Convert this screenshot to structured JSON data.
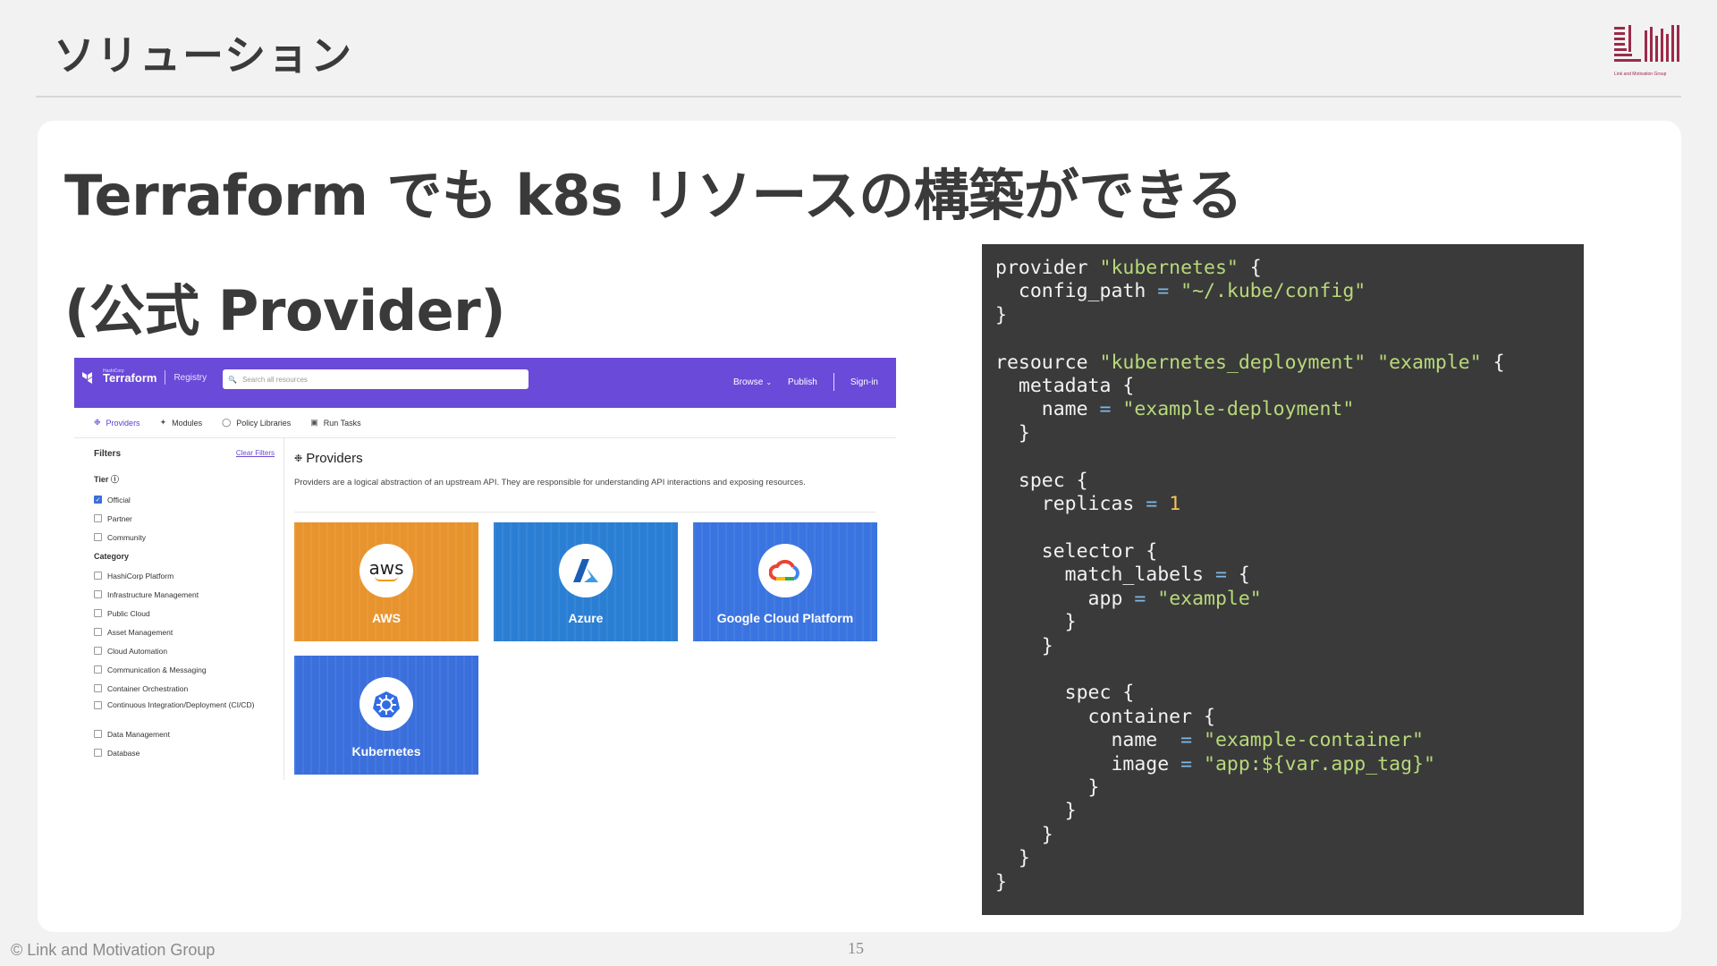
{
  "slide": {
    "title": "ソリューション",
    "headline_line1": "Terraform でも k8s リソースの構築ができる",
    "headline_line2": "(公式 Provider)",
    "page_number": "15",
    "footer": "© Link and Motivation Group",
    "logo_caption": "Link and Motivation Group"
  },
  "registry": {
    "brand_small": "HashiCorp",
    "brand_name": "Terraform",
    "brand_section": "Registry",
    "search_placeholder": "Search all resources",
    "nav": {
      "browse": "Browse",
      "publish": "Publish",
      "signin": "Sign-in"
    },
    "tabs": [
      {
        "label": "Providers",
        "icon": "provider-icon"
      },
      {
        "label": "Modules",
        "icon": "module-icon"
      },
      {
        "label": "Policy Libraries",
        "icon": "shield-icon"
      },
      {
        "label": "Run Tasks",
        "icon": "run-task-icon"
      }
    ],
    "filters": {
      "title": "Filters",
      "clear": "Clear Filters",
      "tier_label": "Tier",
      "tiers": [
        {
          "label": "Official",
          "checked": true
        },
        {
          "label": "Partner",
          "checked": false
        },
        {
          "label": "Community",
          "checked": false
        }
      ],
      "category_label": "Category",
      "categories": [
        "HashiCorp Platform",
        "Infrastructure Management",
        "Public Cloud",
        "Asset Management",
        "Cloud Automation",
        "Communication & Messaging",
        "Container Orchestration",
        "Continuous Integration/Deployment (CI/CD)",
        "Data Management",
        "Database"
      ]
    },
    "main": {
      "title": "Providers",
      "description": "Providers are a logical abstraction of an upstream API. They are responsible for understanding API interactions and exposing resources.",
      "tiles": [
        {
          "name": "AWS",
          "logo": "aws-logo",
          "color": "#e8942e"
        },
        {
          "name": "Azure",
          "logo": "azure-logo",
          "color": "#2a7fd4"
        },
        {
          "name": "Google Cloud Platform",
          "logo": "gcp-logo",
          "color": "#3a74e0"
        },
        {
          "name": "Kubernetes",
          "logo": "kubernetes-logo",
          "color": "#3a6fdc"
        }
      ]
    }
  },
  "code": {
    "language": "hcl",
    "lines": [
      "provider \"kubernetes\" {",
      "  config_path = \"~/.kube/config\"",
      "}",
      "",
      "resource \"kubernetes_deployment\" \"example\" {",
      "  metadata {",
      "    name = \"example-deployment\"",
      "  }",
      "",
      "  spec {",
      "    replicas = 1",
      "",
      "    selector {",
      "      match_labels = {",
      "        app = \"example\"",
      "      }",
      "    }",
      "",
      "      spec {",
      "        container {",
      "          name  = \"example-container\"",
      "          image = \"app:${var.app_tag}\"",
      "        }",
      "      }",
      "    }",
      "  }",
      "}"
    ]
  },
  "colors": {
    "accent_purple": "#6a4ad8",
    "code_bg": "#3a3a3a",
    "code_string": "#b8d97a",
    "code_operator": "#7fb8e6",
    "code_number": "#f4c25a",
    "brand_red": "#9b2a4a"
  }
}
